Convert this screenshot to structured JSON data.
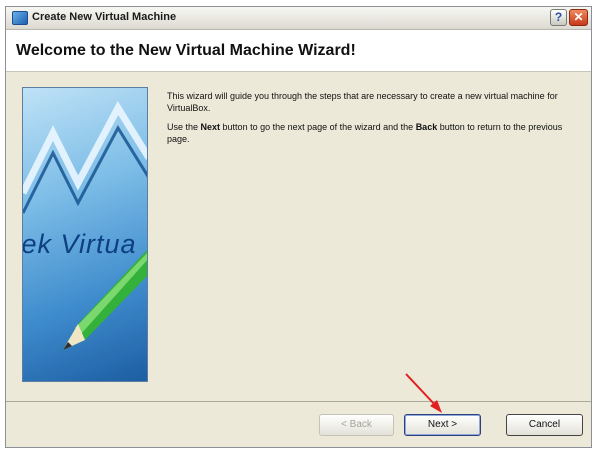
{
  "window": {
    "title": "Create New Virtual Machine",
    "help_glyph": "?",
    "close_glyph": "✕"
  },
  "header": {
    "heading": "Welcome to the New Virtual Machine Wizard!"
  },
  "image": {
    "text": "tek Virtua"
  },
  "intro": {
    "p1": "This wizard will guide you through the steps that are necessary to create a new virtual machine for VirtualBox.",
    "p2_a": "Use the ",
    "p2_next": "Next",
    "p2_b": " button to go the next page of the wizard and the ",
    "p2_back": "Back",
    "p2_c": " button to return to the previous page."
  },
  "buttons": {
    "back": "< Back",
    "next": "Next >",
    "cancel": "Cancel"
  },
  "colors": {
    "accent": "#2b4fa3",
    "close": "#c7391c",
    "arrow": "#e02020"
  },
  "icons": [
    "app-icon",
    "help-icon",
    "close-icon",
    "red-arrow-icon"
  ]
}
